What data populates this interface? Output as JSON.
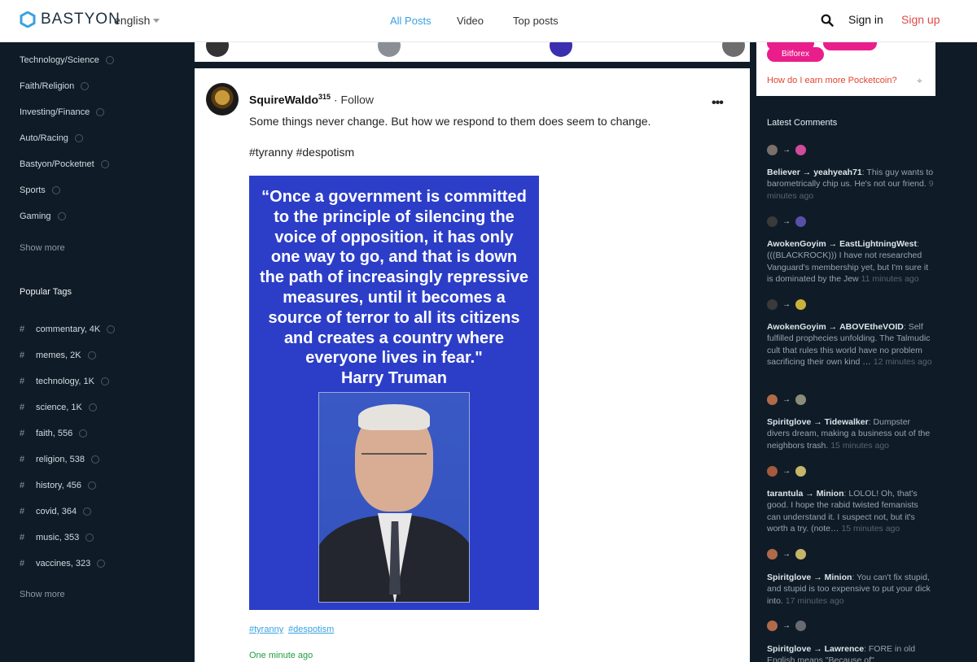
{
  "header": {
    "brand": "BASTYON",
    "language": "english",
    "nav": [
      "All Posts",
      "Video",
      "Top posts"
    ],
    "active_nav": "All Posts",
    "signin": "Sign in",
    "signup": "Sign up",
    "colors": {
      "accent": "#3aa1e0",
      "signup": "#e24848"
    }
  },
  "sidebar": {
    "categories": [
      "Technology/Science",
      "Faith/Religion",
      "Investing/Finance",
      "Auto/Racing",
      "Bastyon/Pocketnet",
      "Sports",
      "Gaming"
    ],
    "show_more_1": "Show more",
    "popular_heading": "Popular Tags",
    "tags": [
      {
        "label": "commentary, 4K"
      },
      {
        "label": "memes, 2K"
      },
      {
        "label": "technology, 1K"
      },
      {
        "label": "science, 1K"
      },
      {
        "label": "faith, 556"
      },
      {
        "label": "religion, 538"
      },
      {
        "label": "history, 456"
      },
      {
        "label": "covid, 364"
      },
      {
        "label": "music, 353"
      },
      {
        "label": "vaccines, 323"
      }
    ],
    "show_more_2": "Show more",
    "hash": "#"
  },
  "post": {
    "author": "SquireWaldo",
    "reputation": "315",
    "follow": "· Follow",
    "menu": "•••",
    "text": "Some things never change. But how we respond to them does seem to change.",
    "hashtags": "#tyranny #despotism",
    "quote_lines": [
      "“Once a government is committed",
      "to the principle of silencing the",
      "voice of opposition, it has only",
      "one way to go, and that is down",
      "the path of increasingly repressive",
      "measures, until it becomes a",
      "source of terror to all its citizens",
      "and creates a country where",
      "everyone lives in fear.\"",
      "Harry Truman"
    ],
    "tag_links": [
      "#tyranny",
      "#despotism"
    ],
    "time": "One minute ago"
  },
  "right": {
    "pill": "Bitforex",
    "earn_link": "How do I earn more Pocketcoin?",
    "latest_heading": "Latest Comments",
    "arrow": "→",
    "comments": [
      {
        "from": "Believer",
        "to": "yeahyeah71",
        "text": ": This guy wants to barometrically chip us. He's not our friend.",
        "time": "9 minutes ago",
        "c1": "#7b6f6a",
        "c2": "#d24a9a"
      },
      {
        "from": "AwokenGoyim",
        "to": "EastLightningWest",
        "text": ": (((BLACKROCK))) I have not researched Vanguard's membership yet, but I'm sure it is dominated by the Jew",
        "time": "11 minutes ago",
        "c1": "#3a3a3a",
        "c2": "#5a4fa8"
      },
      {
        "from": "AwokenGoyim",
        "to": "ABOVEtheVOID",
        "text": ": Self fulfilled prophecies unfolding. The Talmudic cult that rules this world have no problem sacrificing their own kind …",
        "time": "12 minutes ago",
        "c1": "#3a3a3a",
        "c2": "#c9b23a"
      },
      {
        "from": "Spiritglove",
        "to": "Tidewalker",
        "text": ": Dumpster divers dream, making a business out of the neighbors trash.",
        "time": "15 minutes ago",
        "c1": "#b06a4a",
        "c2": "#8c8c7a"
      },
      {
        "from": "tarantula",
        "to": "Minion",
        "text": ": LOLOL! Oh, that's good. I hope the rabid twisted femanists can understand it. I suspect not, but it's worth a try. (note…",
        "time": "15 minutes ago",
        "c1": "#a45a3c",
        "c2": "#c6b66a"
      },
      {
        "from": "Spiritglove",
        "to": "Minion",
        "text": ": You can't fix stupid, and stupid is too expensive to put your dick into.",
        "time": "17 minutes ago",
        "c1": "#b06a4a",
        "c2": "#c6b66a"
      },
      {
        "from": "Spiritglove",
        "to": "Lawrence",
        "text": ": FORE in old English means \"Because of\"",
        "time": "",
        "c1": "#b06a4a",
        "c2": "#6a6a72"
      }
    ]
  }
}
